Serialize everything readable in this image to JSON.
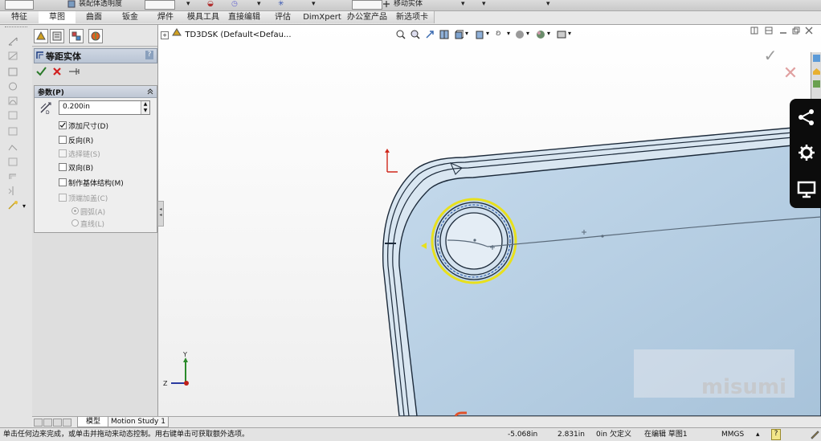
{
  "top_toolbar": {
    "transparency_label": "装配体透明度",
    "move_entity_label": "移动实体"
  },
  "tabs": [
    {
      "label": "特征",
      "active": false
    },
    {
      "label": "草图",
      "active": true
    },
    {
      "label": "曲面",
      "active": false
    },
    {
      "label": "钣金",
      "active": false
    },
    {
      "label": "焊件",
      "active": false
    },
    {
      "label": "模具工具",
      "active": false
    },
    {
      "label": "直接编辑",
      "active": false
    },
    {
      "label": "评估",
      "active": false
    },
    {
      "label": "DimXpert",
      "active": false
    },
    {
      "label": "办公室产品",
      "active": false
    },
    {
      "label": "新选项卡",
      "active": false
    }
  ],
  "property_manager": {
    "title": "等距实体",
    "help_icon": "?",
    "actions": {
      "ok_icon": "checkmark-icon",
      "cancel_icon": "x-icon",
      "pin_icon": "pushpin-icon"
    },
    "params_group": {
      "label": "参数(P)",
      "distance_value": "0.200in",
      "options": [
        {
          "label": "添加尺寸(D)",
          "checked": true,
          "enabled": true
        },
        {
          "label": "反向(R)",
          "checked": false,
          "enabled": true
        },
        {
          "label": "选择链(S)",
          "checked": false,
          "enabled": false
        },
        {
          "label": "双向(B)",
          "checked": false,
          "enabled": true
        },
        {
          "label": "制作基体结构(M)",
          "checked": false,
          "enabled": true
        },
        {
          "label": "顶端加盖(C)",
          "checked": false,
          "enabled": false
        }
      ],
      "cap_options": [
        {
          "label": "圆弧(A)",
          "selected": true
        },
        {
          "label": "直线(L)",
          "selected": false
        }
      ]
    }
  },
  "viewport": {
    "tree_root": "TD3DSK  (Default<Defau...",
    "watermark": "misumi",
    "triad_axes": {
      "y": "Y",
      "z": "Z"
    },
    "overlay_icons": [
      "share-icon",
      "gear-icon",
      "monitor-icon"
    ]
  },
  "bottom_tabs": {
    "model": "模型",
    "motion_study": "Motion Study 1"
  },
  "status_bar": {
    "message": "单击任何边来完成，或单击并拖动来动态控制。用右键单击可获取额外选项。",
    "x": "-5.068in",
    "y": "2.831in",
    "z": "0in",
    "constraint": "欠定义",
    "editing": "在编辑 草图1",
    "units": "MMGS",
    "help": "?"
  },
  "colors": {
    "part_face": "#b6cfe4",
    "part_edge": "#1c2a3a",
    "selection": "#e8e01c",
    "overlay": "#0c0c0c",
    "sketch_origin": "#d0281c"
  }
}
